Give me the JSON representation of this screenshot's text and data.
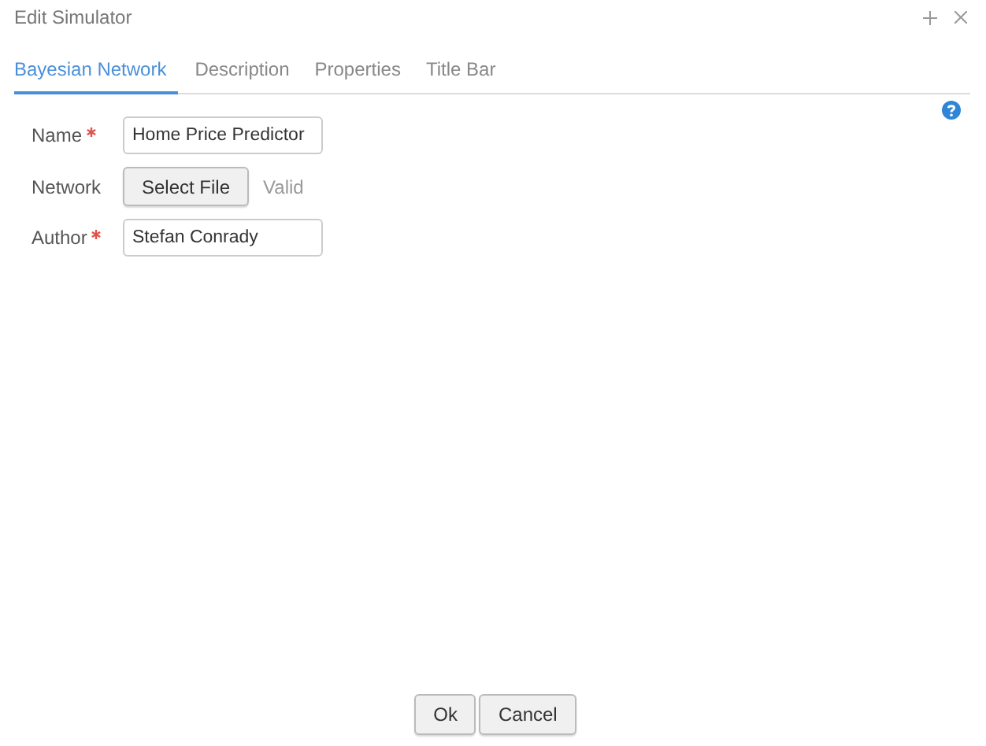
{
  "window": {
    "title": "Edit Simulator"
  },
  "tabs": [
    {
      "label": "Bayesian Network",
      "selected": true
    },
    {
      "label": "Description",
      "selected": false
    },
    {
      "label": "Properties",
      "selected": false
    },
    {
      "label": "Title Bar",
      "selected": false
    }
  ],
  "fields": [
    {
      "kind": "text",
      "label": "Name",
      "required": true,
      "value": "Home Price Predictor"
    },
    {
      "kind": "file",
      "label": "Network",
      "required": false,
      "button": "Select File",
      "status": "Valid"
    },
    {
      "kind": "text",
      "label": "Author",
      "required": true,
      "value": "Stefan Conrady"
    }
  ],
  "buttons": [
    "Ok",
    "Cancel"
  ]
}
